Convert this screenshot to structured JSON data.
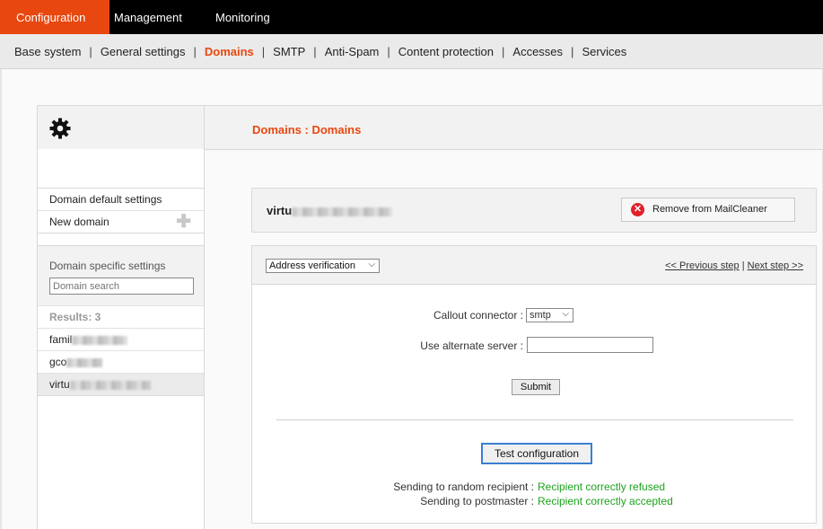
{
  "top_nav": [
    "Configuration",
    "Management",
    "Monitoring"
  ],
  "sub_nav": [
    "Base system",
    "General settings",
    "Domains",
    "SMTP",
    "Anti-Spam",
    "Content protection",
    "Accesses",
    "Services"
  ],
  "page_title": "Domains : Domains",
  "left_menu": {
    "default_settings": "Domain default settings",
    "new_domain": "New domain"
  },
  "specific": {
    "title": "Domain specific settings",
    "search_placeholder": "Domain search",
    "results": "Results: 3",
    "domains": [
      "famil",
      "gco",
      "virtu"
    ]
  },
  "domain_name": "virtu",
  "remove_button": "Remove from MailCleaner",
  "step_select": "Address verification",
  "prev_step": "<< Previous step",
  "next_step": "Next step >>",
  "steps_separator": "|",
  "form": {
    "callout_label": "Callout connector :",
    "callout_value": "smtp",
    "alt_server_label": "Use alternate server :",
    "alt_server_value": "",
    "submit": "Submit",
    "test_button": "Test configuration"
  },
  "results": {
    "random_label": "Sending to random recipient :",
    "random_value": "Recipient correctly refused",
    "postmaster_label": "Sending to postmaster :",
    "postmaster_value": "Recipient correctly accepted"
  },
  "colors": {
    "accent": "#e8470f",
    "success": "#1ea31e",
    "danger": "#e0212b"
  }
}
